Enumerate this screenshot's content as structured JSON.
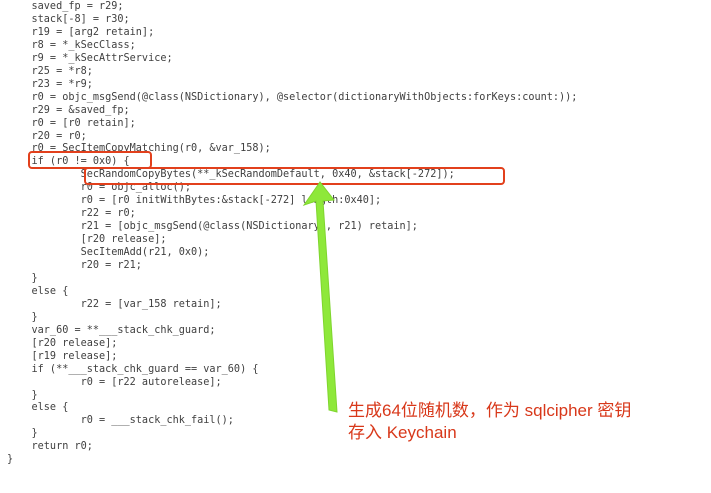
{
  "code_lines": [
    "    saved_fp = r29;",
    "    stack[-8] = r30;",
    "    r19 = [arg2 retain];",
    "    r8 = *_kSecClass;",
    "    r9 = *_kSecAttrService;",
    "    r25 = *r8;",
    "    r23 = *r9;",
    "    r0 = objc_msgSend(@class(NSDictionary), @selector(dictionaryWithObjects:forKeys:count:));",
    "    r29 = &saved_fp;",
    "    r0 = [r0 retain];",
    "    r20 = r0;",
    "    r0 = SecItemCopyMatching(r0, &var_158);",
    "    if (r0 != 0x0) {",
    "            SecRandomCopyBytes(**_kSecRandomDefault, 0x40, &stack[-272]);",
    "            r0 = objc_alloc();",
    "            r0 = [r0 initWithBytes:&stack[-272] length:0x40];",
    "            r22 = r0;",
    "            r21 = [objc_msgSend(@class(NSDictionary), r21) retain];",
    "            [r20 release];",
    "            SecItemAdd(r21, 0x0);",
    "            r20 = r21;",
    "    }",
    "    else {",
    "            r22 = [var_158 retain];",
    "    }",
    "    var_60 = **___stack_chk_guard;",
    "    [r20 release];",
    "    [r19 release];",
    "    if (**___stack_chk_guard == var_60) {",
    "            r0 = [r22 autorelease];",
    "    }",
    "    else {",
    "            r0 = ___stack_chk_fail();",
    "    }",
    "    return r0;",
    "}"
  ],
  "annotation": {
    "line1": "生成64位随机数，作为 sqlcipher 密钥",
    "line2": "存入 Keychain"
  },
  "colors": {
    "highlight_box": "#e2401c",
    "arrow": "#8ee83a",
    "annotation_text": "#d8381a"
  }
}
